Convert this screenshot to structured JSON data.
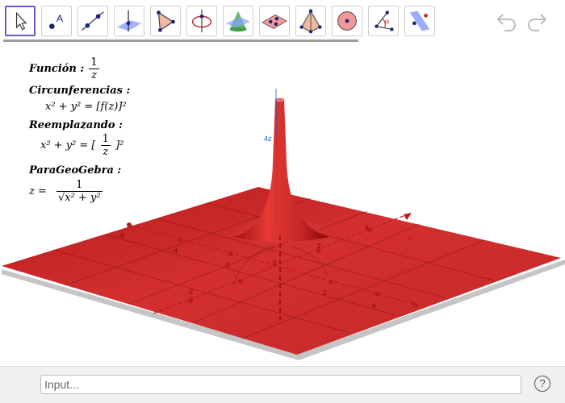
{
  "toolbar": {
    "tools": [
      {
        "name": "Move",
        "icon": "move-arrow-icon",
        "active": true
      },
      {
        "name": "Point",
        "icon": "point-icon"
      },
      {
        "name": "Line",
        "icon": "line-icon"
      },
      {
        "name": "Perpendicular Line",
        "icon": "perpendicular-line-icon"
      },
      {
        "name": "Polygon",
        "icon": "polygon-icon"
      },
      {
        "name": "Circle with Axis",
        "icon": "circle-axis-icon"
      },
      {
        "name": "Intersect Two Surfaces",
        "icon": "intersect-surfaces-icon"
      },
      {
        "name": "Plane",
        "icon": "plane-icon"
      },
      {
        "name": "Pyramid",
        "icon": "pyramid-icon"
      },
      {
        "name": "Sphere",
        "icon": "sphere-icon"
      },
      {
        "name": "Angle",
        "icon": "angle-icon"
      },
      {
        "name": "Reflect about Plane",
        "icon": "reflect-plane-icon"
      }
    ],
    "undo_icon": "undo-icon",
    "redo_icon": "redo-icon"
  },
  "text": {
    "funcion_label": "Función :",
    "funcion_num": "1",
    "funcion_den": "z",
    "circ_label": "Circunferencias :",
    "circ_eq_lhs": "x² + y² = [f(z)]²",
    "reemp_label": "Reemplazando :",
    "reemp_lhs": "x² + y² = [",
    "reemp_num": "1",
    "reemp_den": "z",
    "reemp_rhs": "]²",
    "para_label": "ParaGeoGebra :",
    "para_lhs": "z =",
    "para_num": "1",
    "para_den": "x² + y²"
  },
  "axes": {
    "z_label": "4z",
    "y_label": "y",
    "x_ticks": [
      "-2",
      "2",
      "4"
    ],
    "y_ticks": [
      "-6",
      "-4",
      "-2",
      "2",
      "4"
    ],
    "z_ticks": [
      "0"
    ]
  },
  "colors": {
    "surface": "#c62828",
    "surface_dark": "#8b0000",
    "axis": "#b71c1c",
    "tool_active_border": "#6557d2",
    "point_blue": "#1a237e"
  },
  "input": {
    "placeholder": "Input..."
  },
  "help": {
    "label": "?"
  }
}
